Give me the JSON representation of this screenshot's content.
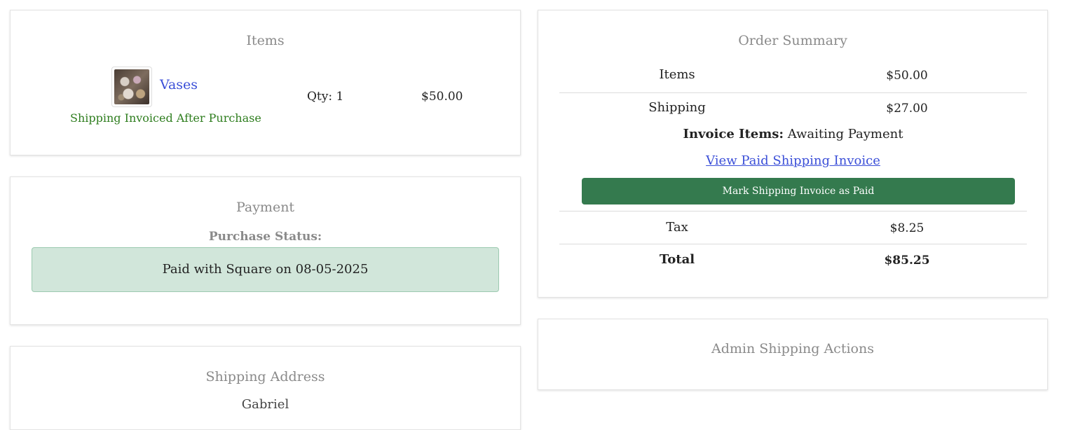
{
  "items_card": {
    "title": "Items",
    "item": {
      "name": "Vases",
      "note": "Shipping Invoiced After Purchase",
      "qty": "Qty: 1",
      "price": "$50.00",
      "thumbnail_icon": "product-photo"
    }
  },
  "payment_card": {
    "title": "Payment",
    "status_label": "Purchase Status:",
    "status_message": "Paid with Square on 08-05-2025"
  },
  "address_card": {
    "title": "Shipping Address",
    "name": "Gabriel"
  },
  "summary_card": {
    "title": "Order Summary",
    "items_label": "Items",
    "items_value": "$50.00",
    "shipping_label": "Shipping",
    "shipping_value": "$27.00",
    "invoice_label": "Invoice Items:",
    "invoice_status": "Awaiting Payment",
    "invoice_link": "View Paid Shipping Invoice",
    "mark_paid_button": "Mark Shipping Invoice as Paid",
    "tax_label": "Tax",
    "tax_value": "$8.25",
    "total_label": "Total",
    "total_value": "$85.25"
  },
  "admin_card": {
    "title": "Admin Shipping Actions"
  },
  "colors": {
    "link": "#3b4fd8",
    "note_green": "#2e7d1e",
    "button_green": "#347a4e",
    "paid_bg": "#d1e6da"
  }
}
